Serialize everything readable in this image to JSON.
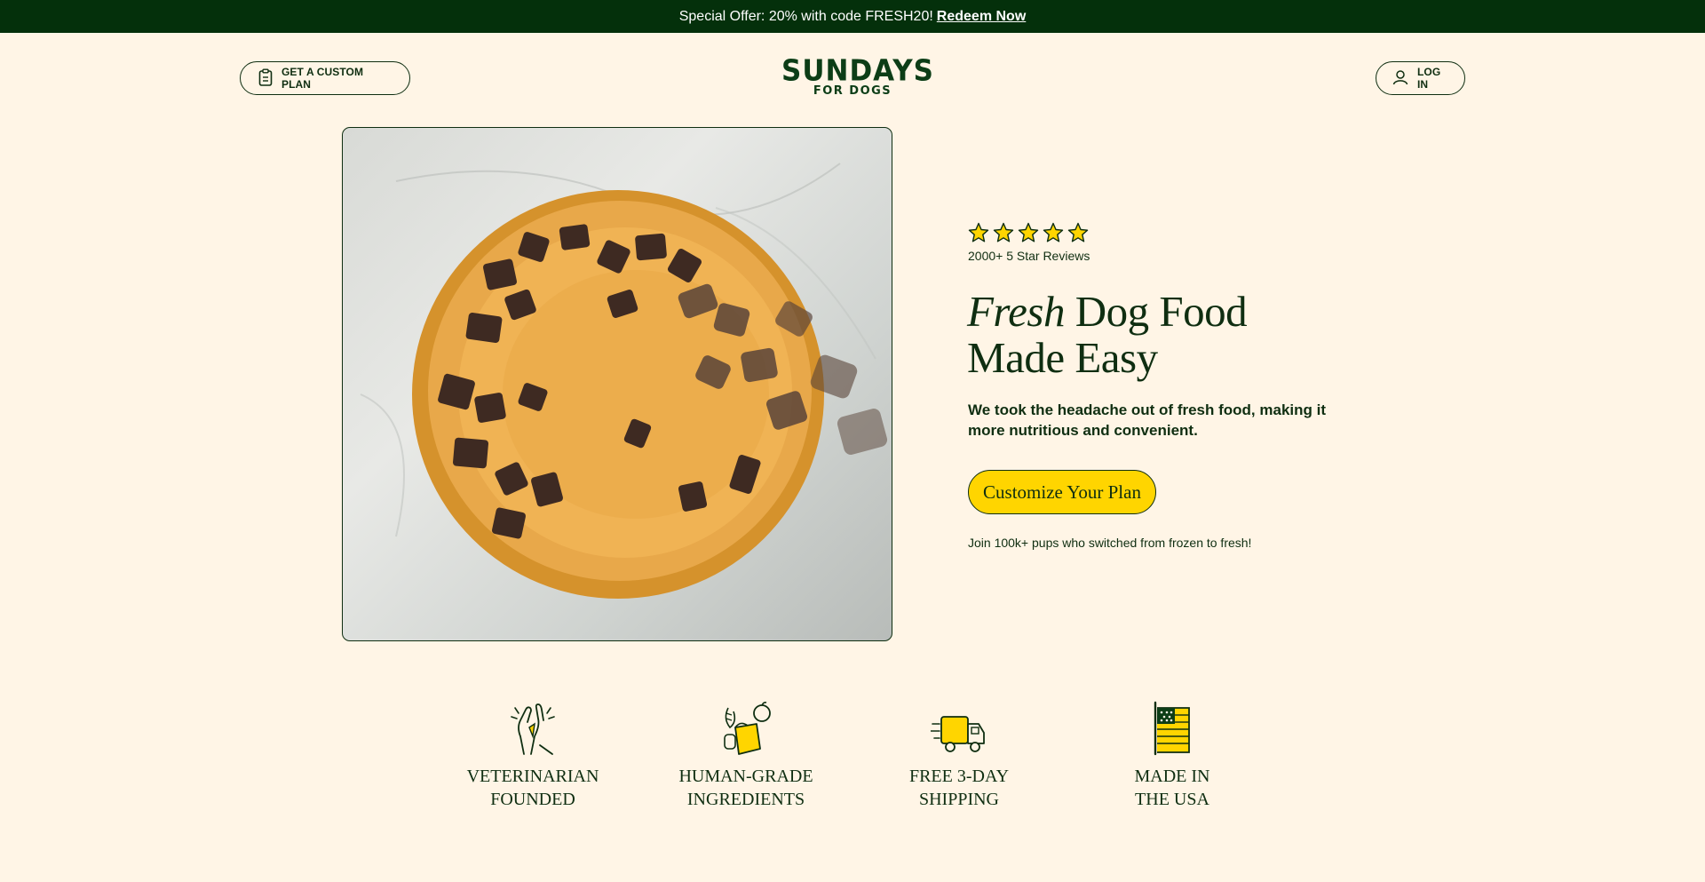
{
  "promo": {
    "text": "Special Offer: 20% with code FRESH20!",
    "link": "Redeem Now"
  },
  "header": {
    "plan_button": "GET A CUSTOM PLAN",
    "logo_top": "SUNDAYS",
    "logo_bottom": "FOR DOGS",
    "login_button": "LOG IN"
  },
  "hero": {
    "rating_stars": 5,
    "reviews": "2000+ 5 Star Reviews",
    "headline_italic": "Fresh",
    "headline_rest": " Dog Food",
    "headline_line2": "Made Easy",
    "subtext": "We took the headache out of fresh food, making it more nutritious and convenient.",
    "cta": "Customize Your Plan",
    "join_text": "Join 100k+ pups who switched from frozen to fresh!"
  },
  "features": [
    {
      "line1": "VETERINARIAN",
      "line2": "FOUNDED",
      "icon": "high-five-icon"
    },
    {
      "line1": "HUMAN-GRADE",
      "line2": "INGREDIENTS",
      "icon": "ingredients-icon"
    },
    {
      "line1": "FREE 3-DAY",
      "line2": "SHIPPING",
      "icon": "delivery-truck-icon"
    },
    {
      "line1": "MADE IN",
      "line2": "THE USA",
      "icon": "usa-flag-icon"
    }
  ],
  "colors": {
    "background": "#fff5e6",
    "promo_bar": "#04300b",
    "text": "#0f2e11",
    "accent_yellow": "#ffd500"
  }
}
